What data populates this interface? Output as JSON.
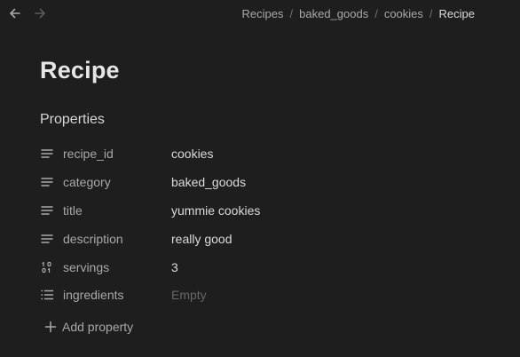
{
  "nav": {
    "back_icon": "arrow-left-icon",
    "forward_icon": "arrow-right-icon"
  },
  "breadcrumb": {
    "items": [
      "Recipes",
      "baked_goods",
      "cookies",
      "Recipe"
    ],
    "separator": "/"
  },
  "page": {
    "title": "Recipe",
    "properties_heading": "Properties"
  },
  "properties": [
    {
      "name": "recipe_id",
      "value": "cookies",
      "icon": "text-icon"
    },
    {
      "name": "category",
      "value": "baked_goods",
      "icon": "text-icon"
    },
    {
      "name": "title",
      "value": "yummie cookies",
      "icon": "text-icon"
    },
    {
      "name": "description",
      "value": "really good",
      "icon": "text-icon"
    },
    {
      "name": "servings",
      "value": "3",
      "icon": "number-icon"
    },
    {
      "name": "ingredients",
      "value": "Empty",
      "icon": "list-icon"
    }
  ],
  "add_property": {
    "label": "Add property",
    "icon": "plus-icon"
  },
  "colors": {
    "background": "#1e1e1e",
    "text_primary": "#dadada",
    "text_muted": "#a8a8a8",
    "text_faint": "#676767"
  }
}
